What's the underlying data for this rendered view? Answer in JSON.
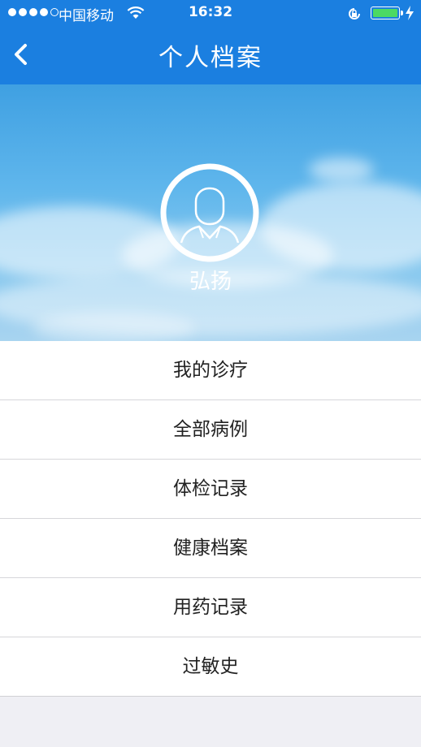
{
  "status_bar": {
    "carrier": "中国移动",
    "time": "16:32",
    "battery_color": "#4cd964"
  },
  "nav": {
    "title": "个人档案",
    "back_icon": "chevron-left-icon",
    "bar_color": "#1b7fe0"
  },
  "profile": {
    "name": "弘扬",
    "avatar_icon": "user-avatar-icon"
  },
  "menu": {
    "items": [
      {
        "label": "我的诊疗"
      },
      {
        "label": "全部病例"
      },
      {
        "label": "体检记录"
      },
      {
        "label": "健康档案"
      },
      {
        "label": "用药记录"
      },
      {
        "label": "过敏史"
      }
    ]
  }
}
